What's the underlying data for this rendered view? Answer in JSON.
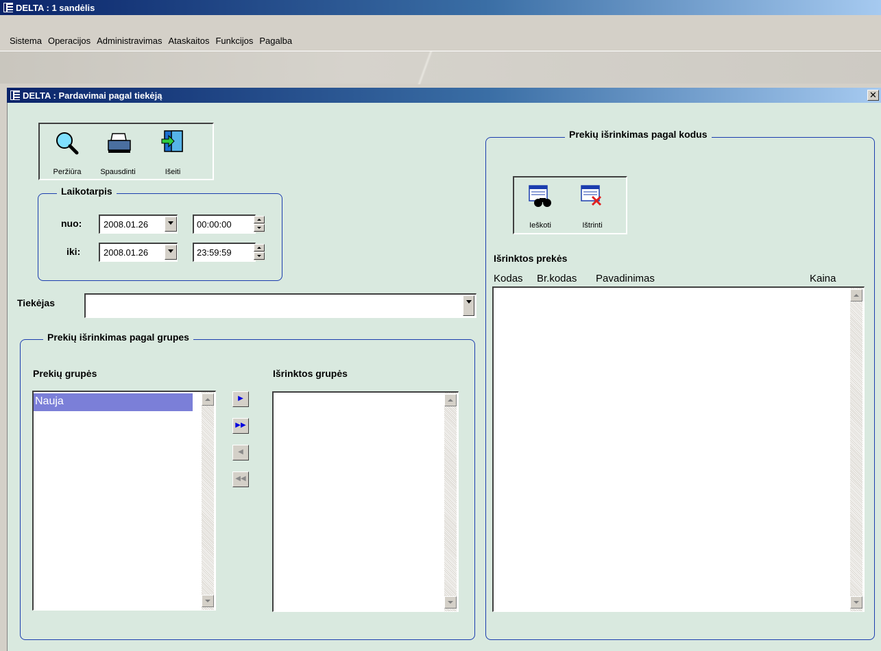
{
  "app": {
    "title": "DELTA : 1 sandėlis"
  },
  "menu": [
    "Sistema",
    "Operacijos",
    "Administravimas",
    "Ataskaitos",
    "Funkcijos",
    "Pagalba"
  ],
  "child_window": {
    "title": "DELTA : Pardavimai pagal tiekėją",
    "close_glyph": "✕"
  },
  "toolbar": {
    "preview": "Peržiūra",
    "print": "Spausdinti",
    "exit": "Išeiti"
  },
  "period": {
    "legend": "Laikotarpis",
    "from_label": "nuo:",
    "from_date": "2008.01.26",
    "from_time": "00:00:00",
    "to_label": "iki:",
    "to_date": "2008.01.26",
    "to_time": "23:59:59"
  },
  "supplier": {
    "label": "Tiekėjas",
    "value": ""
  },
  "groups": {
    "legend": "Prekių išrinkimas pagal grupes",
    "available_label": "Prekių grupės",
    "available_items": [
      "Nauja"
    ],
    "selected_label": "Išrinktos grupės"
  },
  "codes": {
    "legend": "Prekių išrinkimas pagal kodus",
    "search": "Ieškoti",
    "delete": "Ištrinti",
    "list_label": "Išrinktos prekės",
    "columns": [
      "Kodas",
      "Br.kodas",
      "Pavadinimas",
      "Kaina"
    ]
  },
  "colors": {
    "client_bg": "#d9e9df",
    "accent": "#1a3cae",
    "selection": "#7b7fd8"
  }
}
